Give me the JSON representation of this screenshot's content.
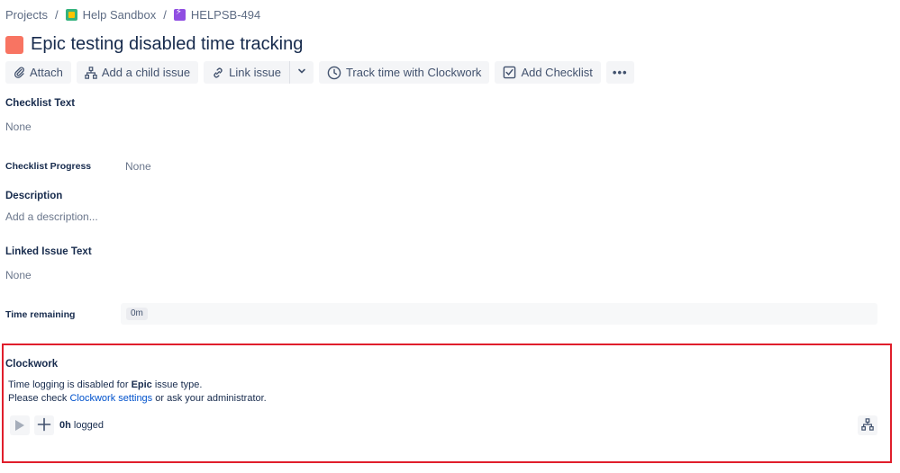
{
  "breadcrumb": {
    "root": "Projects",
    "project": "Help Sandbox",
    "issue_key": "HELPSB-494",
    "separator": "/"
  },
  "issue": {
    "title": "Epic testing disabled time tracking",
    "type_color": "#f87462"
  },
  "toolbar": {
    "attach": "Attach",
    "add_child": "Add a child issue",
    "link_issue": "Link issue",
    "track_time": "Track time with Clockwork",
    "add_checklist": "Add Checklist",
    "more": "•••"
  },
  "fields": {
    "checklist_text_label": "Checklist Text",
    "checklist_text_value": "None",
    "checklist_progress_label": "Checklist Progress",
    "checklist_progress_value": "None",
    "description_label": "Description",
    "description_placeholder": "Add a description...",
    "linked_issue_label": "Linked Issue Text",
    "linked_issue_value": "None",
    "time_remaining_label": "Time remaining",
    "time_remaining_value": "0m"
  },
  "clockwork": {
    "title": "Clockwork",
    "line1_prefix": "Time logging is disabled for ",
    "line1_bold": "Epic",
    "line1_suffix": " issue type.",
    "line2_prefix": "Please check ",
    "line2_link": "Clockwork settings",
    "line2_suffix": " or ask your administrator.",
    "logged_value": "0h",
    "logged_label": " logged",
    "highlight_color": "#e01e2b"
  }
}
